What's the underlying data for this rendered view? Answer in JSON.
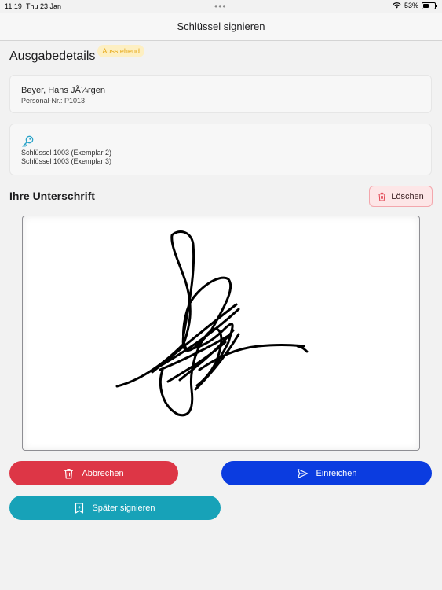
{
  "status_bar": {
    "time": "11.19",
    "date": "Thu 23 Jan",
    "battery": "53%",
    "battery_level": 0.53
  },
  "nav": {
    "title": "Schlüssel signieren"
  },
  "details": {
    "title": "Ausgabedetails",
    "status_badge": "Ausstehend",
    "person": {
      "name": "Beyer, Hans JÃ¼rgen",
      "personnel_no": "Personal-Nr.: P1013"
    },
    "keys": [
      "Schlüssel 1003 (Exemplar 2)",
      "Schlüssel 1003 (Exemplar 3)"
    ]
  },
  "signature": {
    "title": "Ihre Unterschrift",
    "clear_label": "Löschen"
  },
  "actions": {
    "cancel_label": "Abbrechen",
    "submit_label": "Einreichen",
    "later_label": "Später signieren"
  },
  "colors": {
    "cancel": "#dd3646",
    "submit": "#0b3ce0",
    "later": "#17a2b8",
    "badge_bg": "#fdefc2",
    "badge_text": "#e6a817",
    "key_icon": "#2aa3c8"
  },
  "icons": {
    "wifi": "wifi-icon",
    "battery": "battery-icon",
    "key": "key-icon",
    "trash": "trash-icon",
    "send": "send-icon",
    "bookmark": "bookmark-add-icon"
  }
}
